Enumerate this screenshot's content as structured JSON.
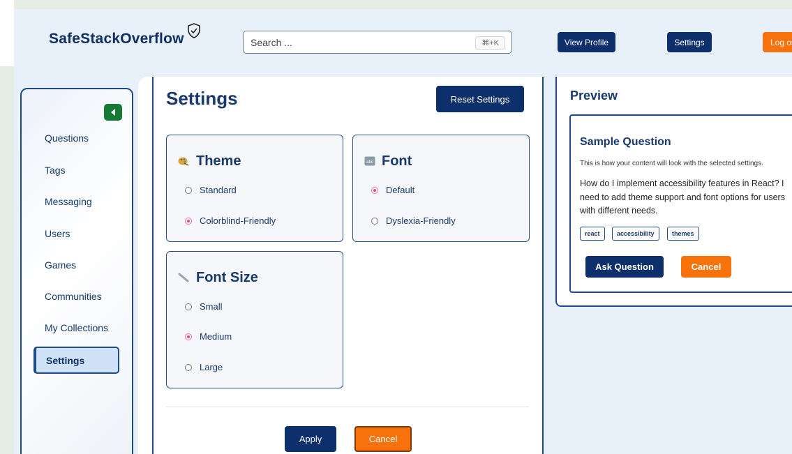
{
  "header": {
    "logo_text": "SafeStackOverflow",
    "logo_icon": "shield-check-icon",
    "search_placeholder": "Search ...",
    "search_shortcut": "⌘+K",
    "view_profile_label": "View Profile",
    "settings_label": "Settings",
    "logout_label": "Log out"
  },
  "sidebar": {
    "back_icon": "caret-left-icon",
    "items": [
      {
        "label": "Questions"
      },
      {
        "label": "Tags"
      },
      {
        "label": "Messaging"
      },
      {
        "label": "Users"
      },
      {
        "label": "Games"
      },
      {
        "label": "Communities"
      },
      {
        "label": "My Collections"
      },
      {
        "label": "Settings",
        "active": true
      }
    ]
  },
  "settings": {
    "title": "Settings",
    "reset_label": "Reset Settings",
    "theme": {
      "title": "Theme",
      "icon": "palette-icon",
      "options": [
        {
          "label": "Standard",
          "selected": false
        },
        {
          "label": "Colorblind-Friendly",
          "selected": true
        }
      ]
    },
    "font": {
      "title": "Font",
      "icon": "font-abc-icon",
      "options": [
        {
          "label": "Default",
          "selected": true
        },
        {
          "label": "Dyslexia-Friendly",
          "selected": false
        }
      ]
    },
    "font_size": {
      "title": "Font Size",
      "icon": "ruler-icon",
      "options": [
        {
          "label": "Small",
          "selected": false
        },
        {
          "label": "Medium",
          "selected": true
        },
        {
          "label": "Large",
          "selected": false
        }
      ]
    },
    "apply_label": "Apply",
    "cancel_label": "Cancel"
  },
  "preview": {
    "title": "Preview",
    "sample_title": "Sample Question",
    "sample_subtitle": "This is how your content will look with the selected settings.",
    "sample_body": "How do I implement accessibility features in React? I need to add theme support and font options for users with different needs.",
    "tags": [
      "react",
      "accessibility",
      "themes"
    ],
    "ask_label": "Ask Question",
    "cancel_label": "Cancel"
  },
  "colors": {
    "navy": "#0d2f6b",
    "orange": "#f7720a",
    "green": "#157a34",
    "radio_selected": "#e3428f"
  }
}
